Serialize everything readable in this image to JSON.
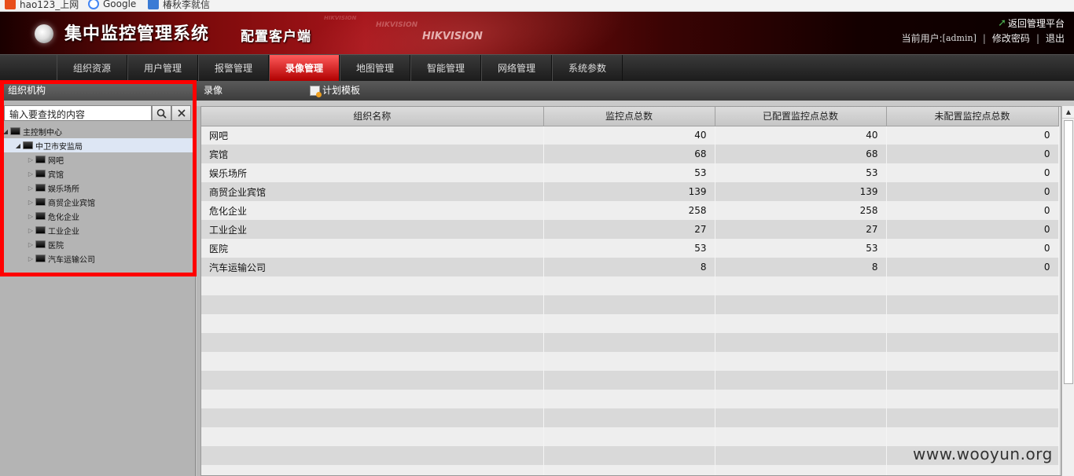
{
  "bookmarks": [
    {
      "label": "hao123_上网"
    },
    {
      "label": "Google"
    },
    {
      "label": "椿秋李就信"
    }
  ],
  "header": {
    "title": "集中监控管理系统",
    "subtitle": "配置客户端",
    "brand": "HIKVISION",
    "back_link": "返回管理平台",
    "current_user_label": "当前用户:",
    "current_user": "[admin]",
    "change_password": "修改密码",
    "logout": "退出"
  },
  "nav": {
    "items": [
      {
        "label": "组织资源"
      },
      {
        "label": "用户管理"
      },
      {
        "label": "报警管理"
      },
      {
        "label": "录像管理",
        "active": true
      },
      {
        "label": "地图管理"
      },
      {
        "label": "智能管理"
      },
      {
        "label": "网络管理"
      },
      {
        "label": "系统参数"
      }
    ]
  },
  "sidebar": {
    "title": "组织机构",
    "search_placeholder": "输入要查找的内容",
    "tree": {
      "root": "主控制中心",
      "child": "中卫市安监局",
      "leaves": [
        "网吧",
        "宾馆",
        "娱乐场所",
        "商贸企业宾馆",
        "危化企业",
        "工业企业",
        "医院",
        "汽车运输公司"
      ]
    }
  },
  "main": {
    "tab_record": "录像",
    "tab_template": "计划模板",
    "columns": [
      "组织名称",
      "监控点总数",
      "已配置监控点总数",
      "未配置监控点总数"
    ],
    "rows": [
      {
        "name": "网吧",
        "total": "40",
        "configured": "40",
        "unconfigured": "0"
      },
      {
        "name": "宾馆",
        "total": "68",
        "configured": "68",
        "unconfigured": "0"
      },
      {
        "name": "娱乐场所",
        "total": "53",
        "configured": "53",
        "unconfigured": "0"
      },
      {
        "name": "商贸企业宾馆",
        "total": "139",
        "configured": "139",
        "unconfigured": "0"
      },
      {
        "name": "危化企业",
        "total": "258",
        "configured": "258",
        "unconfigured": "0"
      },
      {
        "name": "工业企业",
        "total": "27",
        "configured": "27",
        "unconfigured": "0"
      },
      {
        "name": "医院",
        "total": "53",
        "configured": "53",
        "unconfigured": "0"
      },
      {
        "name": "汽车运输公司",
        "total": "8",
        "configured": "8",
        "unconfigured": "0"
      }
    ]
  },
  "watermark": "www.wooyun.org",
  "colors": {
    "nav_active": "#d00000",
    "highlight_box": "#ff0000",
    "header_red": "#a5141a"
  }
}
